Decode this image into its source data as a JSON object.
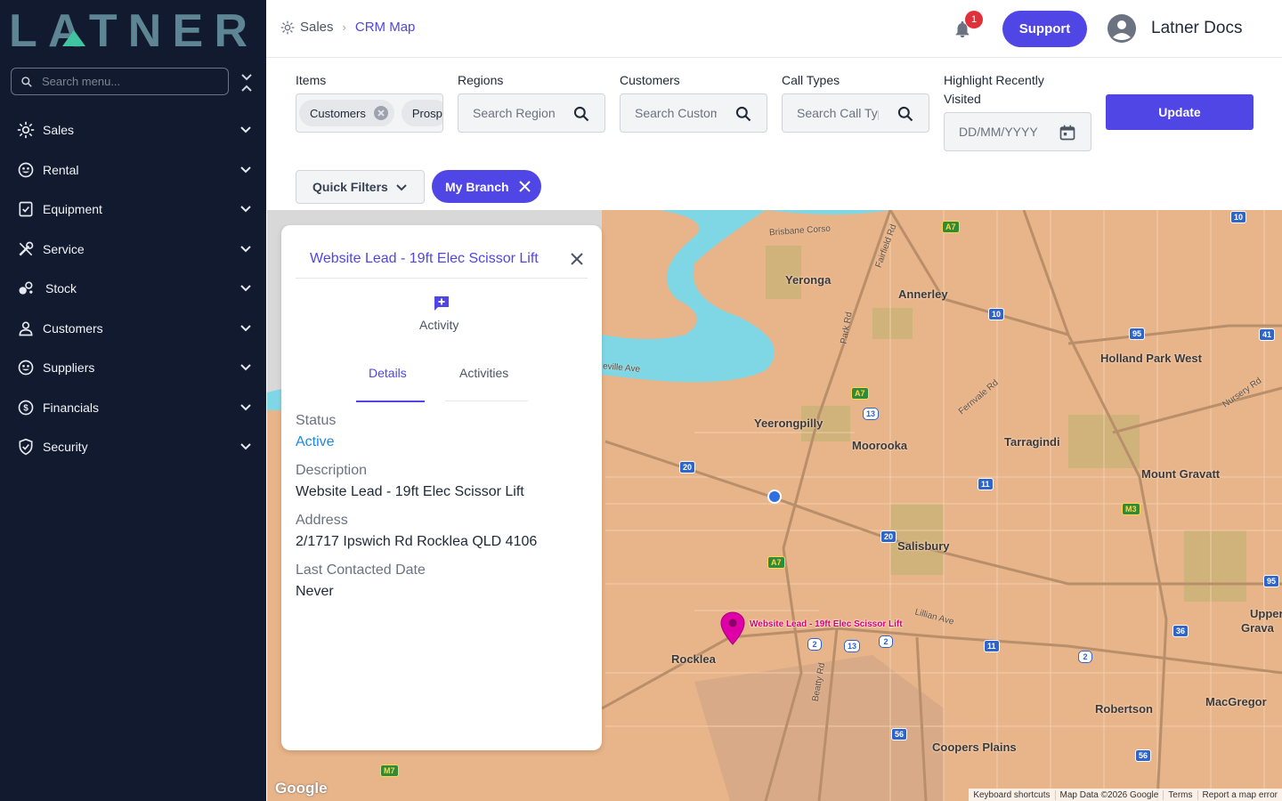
{
  "sidebar": {
    "logo_text": "LATNER",
    "search_placeholder": "Search menu...",
    "items": [
      {
        "label": "Sales",
        "icon": "sales-icon"
      },
      {
        "label": "Rental",
        "icon": "rental-icon"
      },
      {
        "label": "Equipment",
        "icon": "equipment-icon"
      },
      {
        "label": "Service",
        "icon": "service-icon"
      },
      {
        "label": "Stock",
        "icon": "stock-icon"
      },
      {
        "label": "Customers",
        "icon": "customers-icon"
      },
      {
        "label": "Suppliers",
        "icon": "suppliers-icon"
      },
      {
        "label": "Financials",
        "icon": "financials-icon"
      },
      {
        "label": "Security",
        "icon": "security-icon"
      }
    ]
  },
  "header": {
    "breadcrumb": [
      "Sales",
      "CRM Map"
    ],
    "notification_count": "1",
    "support_label": "Support",
    "user_name": "Latner Docs"
  },
  "filters": {
    "items": {
      "label": "Items",
      "chips": [
        "Customers",
        "Prosp"
      ]
    },
    "regions": {
      "label": "Regions",
      "placeholder": "Search Regions"
    },
    "customers": {
      "label": "Customers",
      "placeholder": "Search Customers"
    },
    "call_types": {
      "label": "Call Types",
      "placeholder": "Search Call Types"
    },
    "recent": {
      "label": "Highlight Recently Visited",
      "placeholder": "DD/MM/YYYY"
    },
    "update_label": "Update",
    "quick_filters_label": "Quick Filters",
    "branch_chip": "My Branch"
  },
  "map": {
    "places": [
      "Yeronga",
      "Annerley",
      "Holland Park West",
      "Yeerongpilly",
      "Moorooka",
      "Tarragindi",
      "Mount Gravatt",
      "Salisbury",
      "Rocklea",
      "Robertson",
      "MacGregor",
      "Coopers Plains",
      "Upper M",
      "Grava"
    ],
    "streets": [
      "Brisbane Corso",
      "Fairfield Rd",
      "Park Rd",
      "Fernvale Rd",
      "Nursery Rd",
      "Lillian Ave",
      "Beatty Rd",
      "eville Ave"
    ],
    "shields": [
      "A7",
      "10",
      "10",
      "95",
      "41",
      "A7",
      "13",
      "20",
      "11",
      "M3",
      "20",
      "A7",
      "2",
      "13",
      "2",
      "11",
      "2",
      "36",
      "95",
      "56",
      "56",
      "M7"
    ],
    "pin_label": "Website Lead - 19ft Elec Scissor Lift",
    "google": "Google",
    "attribution": [
      "Keyboard shortcuts",
      "Map Data ©2026 Google",
      "Terms",
      "Report a map error"
    ]
  },
  "panel": {
    "title": "Website Lead - 19ft Elec Scissor Lift",
    "activity_label": "Activity",
    "tabs": [
      "Details",
      "Activities"
    ],
    "fields": [
      {
        "label": "Status",
        "value": "Active"
      },
      {
        "label": "Description",
        "value": "Website Lead - 19ft Elec Scissor Lift"
      },
      {
        "label": "Address",
        "value": "2/1717 Ipswich Rd Rocklea QLD 4106"
      },
      {
        "label": "Last Contacted Date",
        "value": "Never"
      }
    ]
  },
  "colors": {
    "accent": "#4f46e5",
    "sidebar_bg": "#111a2e",
    "status_active": "#1e88e5",
    "pin": "#e000a8"
  }
}
